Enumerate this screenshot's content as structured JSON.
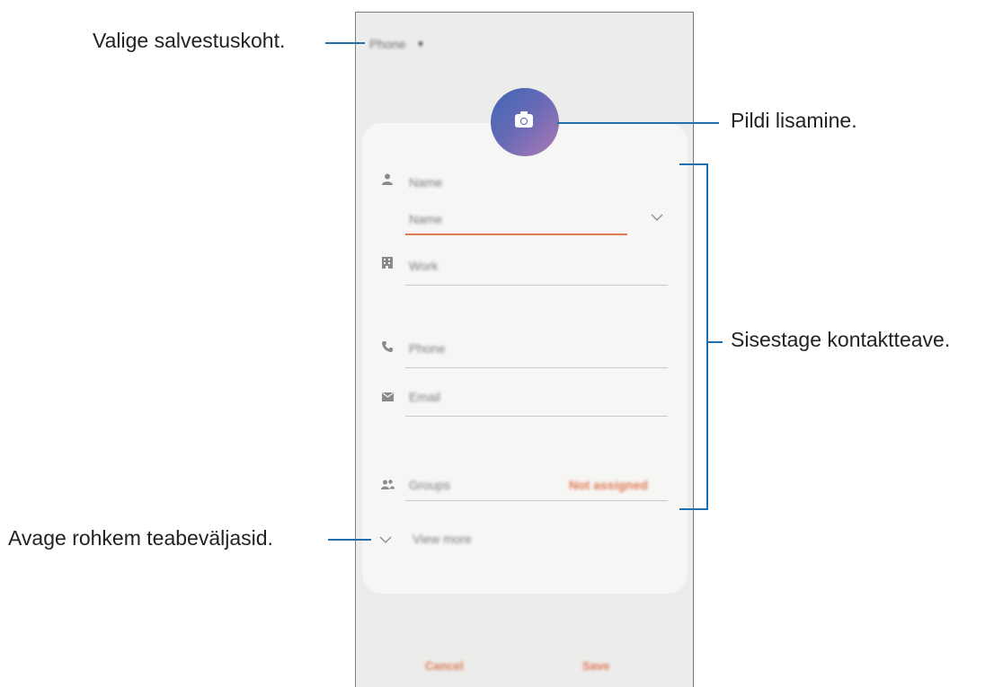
{
  "callouts": {
    "storage": "Valige salvestuskoht.",
    "picture": "Pildi lisamine.",
    "contact_info": "Sisestage kontaktteave.",
    "more_fields": "Avage rohkem teabeväljasid."
  },
  "screen": {
    "storage_location": "Phone",
    "fields": {
      "name_label": "Name",
      "name_input": "Name",
      "work": "Work",
      "phone": "Phone",
      "email": "Email",
      "groups": "Groups",
      "groups_value": "Not assigned",
      "view_more": "View more"
    },
    "buttons": {
      "cancel": "Cancel",
      "save": "Save"
    }
  },
  "colors": {
    "accent": "#e07a55",
    "callout_line": "#1d6fb0"
  }
}
